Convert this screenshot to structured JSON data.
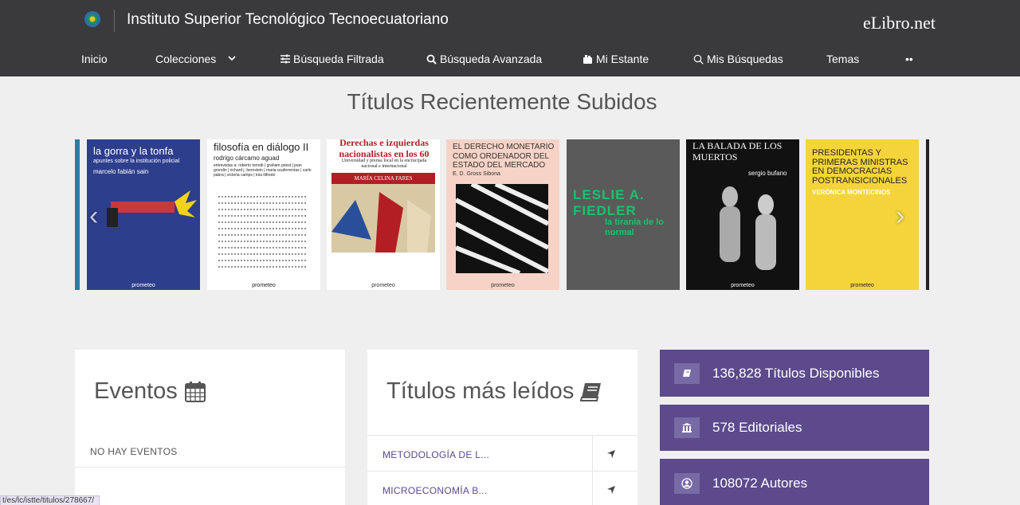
{
  "header": {
    "institution": "Instituto Superior Tecnológico Tecnoecuatoriano",
    "brand": "eLibro.net"
  },
  "nav": [
    {
      "label": "Inicio"
    },
    {
      "label": "Colecciones",
      "icon": "chevron-down-icon"
    },
    {
      "label": "Búsqueda Filtrada",
      "icon": "sliders-icon"
    },
    {
      "label": "Búsqueda Avanzada",
      "icon": "search-icon"
    },
    {
      "label": "Mi Estante",
      "icon": "bookshelf-icon"
    },
    {
      "label": "Mis Búsquedas",
      "icon": "search-icon"
    },
    {
      "label": "Temas"
    },
    {
      "label": "••"
    }
  ],
  "recent_title": "Títulos Recientemente Subidos",
  "books": [
    {
      "title": "la gorra y la tonfa",
      "subtitle": "apuntes sobre la institución policial",
      "author": "marcelo fabián sain",
      "publisher": "prometeo",
      "bg": "#2d3e8c",
      "fg": "#ffffff"
    },
    {
      "title": "filosofía en diálogo II",
      "subtitle": "rodrigo cárcamo aguad",
      "author": "entrevistas a: roberto torretti | graham priest | jean grondin | richard j. bernstein | maria ucaferrentas | carlo pabra | victoria camps | toia litfredo",
      "publisher": "prometeo",
      "bg": "#ffffff",
      "fg": "#222222"
    },
    {
      "title": "Derechas e izquierdas nacionalistas en los 60",
      "subtitle": "Universidad y prensa local en la encrucijada nacional e internacional",
      "author": "MARÍA CELINA FARES",
      "publisher": "prometeo",
      "bg": "#ffffff",
      "fg": "#b21e24"
    },
    {
      "title": "EL DERECHO MONETARIO COMO ORDENADOR DEL ESTADO DEL MERCADO",
      "subtitle": "",
      "author": "E. D. Gross Sibona",
      "publisher": "prometeo",
      "bg": "#f6d3c6",
      "fg": "#333333"
    },
    {
      "title": "LESLIE A. FIEDLER",
      "subtitle": "",
      "author": "la tiranía de lo normal",
      "publisher": "",
      "bg": "#5a5a5a",
      "fg": "#16c46a"
    },
    {
      "title": "LA BALADA DE LOS MUERTOS",
      "subtitle": "",
      "author": "sergio bufano",
      "publisher": "prometeo",
      "bg": "#111111",
      "fg": "#ffffff"
    },
    {
      "title": "PRESIDENTAS Y PRIMERAS MINISTRAS EN DEMOCRACIAS POSTRANSICIONALES",
      "subtitle": "",
      "author": "VERÓNICA MONTECINOS",
      "publisher": "prometeo",
      "bg": "#f4d43a",
      "fg": "#222222"
    }
  ],
  "events": {
    "title": "Eventos",
    "empty": "NO HAY EVENTOS"
  },
  "top": {
    "title": "Títulos más leídos",
    "items": [
      {
        "label": "METODOLOGÍA DE L..."
      },
      {
        "label": "MICROECONOMÍA B..."
      }
    ]
  },
  "stats": [
    {
      "label": "136,828 Títulos Disponibles",
      "icon": "book-icon"
    },
    {
      "label": "578 Editoriales",
      "icon": "bank-icon"
    },
    {
      "label": "108072 Autores",
      "icon": "user-icon"
    }
  ],
  "status_url": "t/es/lc/istte/titulos/278667/"
}
